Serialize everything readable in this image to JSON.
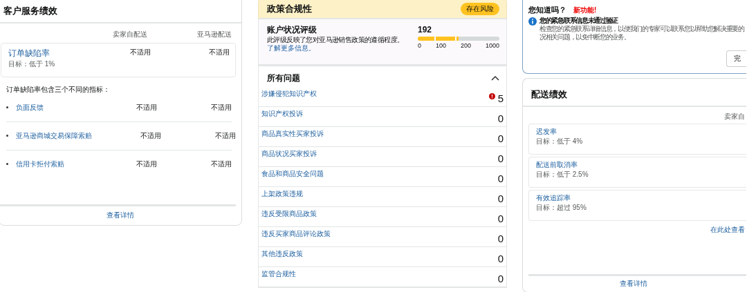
{
  "customer_service": {
    "title": "客户服务绩效",
    "columns": [
      "卖家自配送",
      "亚马逊配送"
    ],
    "metric": {
      "name": "订单缺陷率",
      "target": "目标：低于 1%",
      "values": [
        "不适用",
        "不适用"
      ]
    },
    "intro": "订单缺陷率包含三个不同的指标：",
    "sub_metrics": [
      {
        "name": "负面反馈",
        "values": [
          "不适用",
          "不适用"
        ]
      },
      {
        "name": "亚马逊商城交易保障索赔",
        "values": [
          "不适用",
          "不适用"
        ]
      },
      {
        "name": "信用卡拒付索赔",
        "values": [
          "不适用",
          "不适用"
        ]
      }
    ],
    "footer_link": "查看详情"
  },
  "policy": {
    "title": "政策合规性",
    "badge": "存在风险",
    "rating": {
      "title": "账户状况评级",
      "description": "此评级反映了您对亚马逊销售政策的遵循程度。",
      "link": "了解更多信息。",
      "score": "192",
      "level": 0.5,
      "ticks": [
        "0",
        "100",
        "200",
        "1000"
      ]
    },
    "issues_title": "所有问题",
    "issues_expanded": true,
    "issues": [
      {
        "name": "涉嫌侵犯知识产权",
        "count": "5",
        "alert": true
      },
      {
        "name": "知识产权投诉",
        "count": "0",
        "alert": false
      },
      {
        "name": "商品真实性买家投诉",
        "count": "0",
        "alert": false
      },
      {
        "name": "商品状况买家投诉",
        "count": "0",
        "alert": false
      },
      {
        "name": "食品和商品安全问题",
        "count": "0",
        "alert": false
      },
      {
        "name": "上架政策违规",
        "count": "0",
        "alert": false
      },
      {
        "name": "违反受限商品政策",
        "count": "0",
        "alert": false
      },
      {
        "name": "违反买家商品评论政策",
        "count": "0",
        "alert": false
      },
      {
        "name": "其他违反政策",
        "count": "0",
        "alert": false
      },
      {
        "name": "监管合规性",
        "count": "0",
        "alert": false
      }
    ]
  },
  "notice": {
    "title": "您知道吗？",
    "badge": "新功能!",
    "heading": "您的紧急联系信息未通过验证",
    "body_lines": [
      "检查您的紧急联系详细信息，以便我们的专家可以联系您以帮助您解决重要的",
      "况相关问题，以免中断您的业务。"
    ],
    "button": "完"
  },
  "delivery": {
    "title": "配送绩效",
    "column": "卖家自",
    "metrics": [
      {
        "name": "迟发率",
        "target": "目标：低于 4%"
      },
      {
        "name": "配送前取消率",
        "target": "目标：低于 2.5%"
      },
      {
        "name": "有效追踪率",
        "target": "目标：超过 95%"
      }
    ],
    "link": "在此处查看",
    "footer_link": "查看详情"
  }
}
